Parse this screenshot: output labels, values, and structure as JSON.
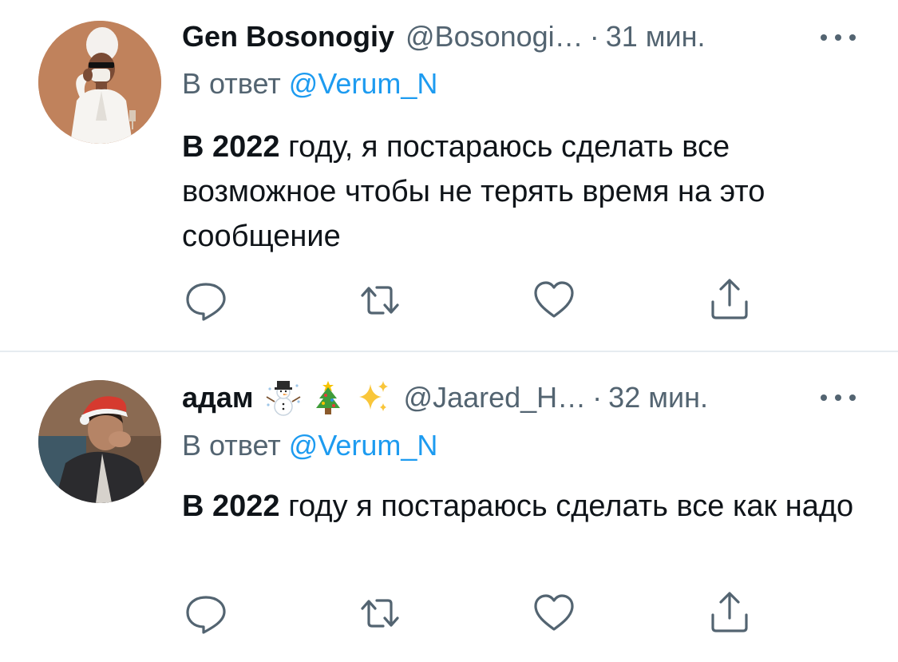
{
  "tweets": [
    {
      "display_name": "Gen Bosonogiy",
      "handle": "@Bosonogi…",
      "separator": "·",
      "time": "31 мин.",
      "reply_prefix": "В ответ",
      "reply_to": "@Verum_N",
      "text_bold": "В 2022",
      "text_rest": " году, я постараюсь сделать все возможное чтобы не терять время на это сообщение",
      "emojis": []
    },
    {
      "display_name": "адам",
      "handle": "@Jaared_H…",
      "separator": "·",
      "time": "32 мин.",
      "reply_prefix": "В ответ",
      "reply_to": "@Verum_N",
      "text_bold": "В 2022",
      "text_rest": " году я постараюсь сделать все как надо",
      "emojis": [
        "snowman-icon",
        "christmas-tree-icon",
        "sparkles-icon"
      ]
    }
  ],
  "colors": {
    "text": "#0f1419",
    "secondary": "#536471",
    "link": "#1d9bf0",
    "icon": "#536471",
    "divider": "#e6ecf0"
  },
  "icons": {
    "actions": [
      "reply-icon",
      "retweet-icon",
      "like-icon",
      "share-icon"
    ],
    "more": "more-icon"
  }
}
